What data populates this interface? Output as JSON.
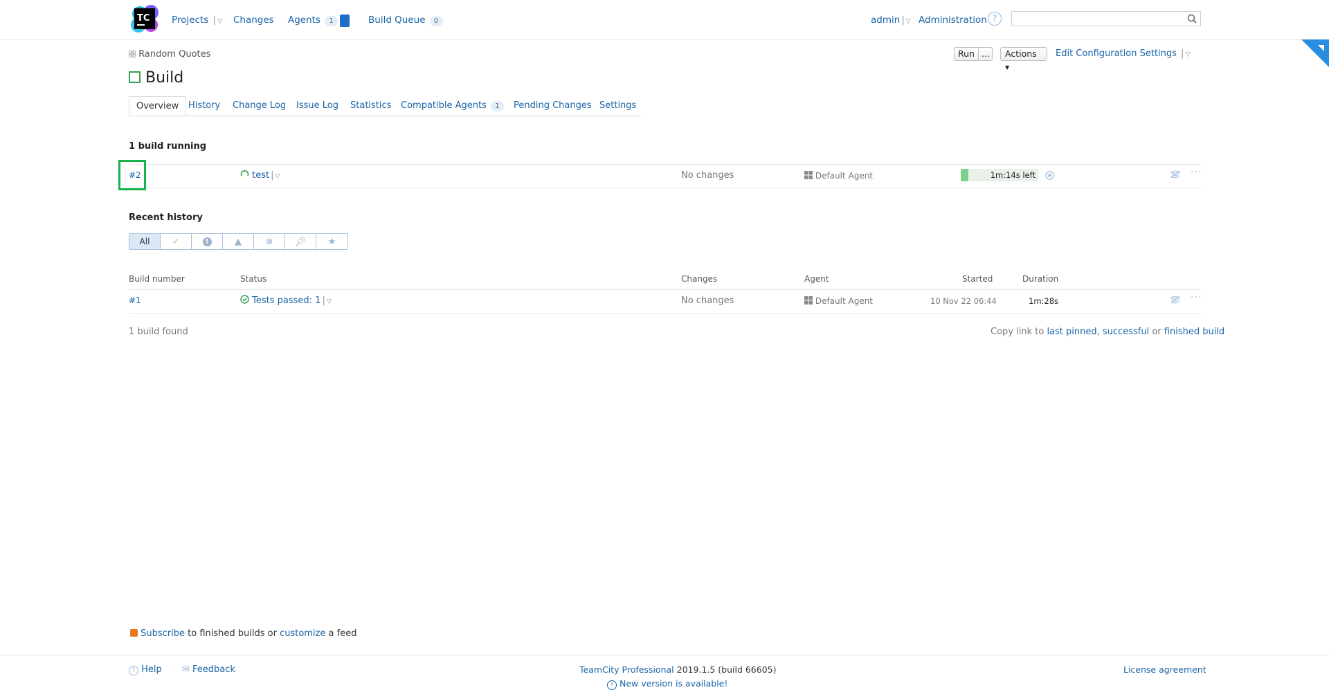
{
  "header": {
    "logo_text": "TC",
    "nav": {
      "projects": "Projects",
      "changes": "Changes",
      "agents": "Agents",
      "agents_count": "1",
      "build_queue": "Build Queue",
      "build_queue_count": "0"
    },
    "user": "admin",
    "administration": "Administration",
    "help_icon": "?",
    "search": {
      "value": "",
      "placeholder": ""
    }
  },
  "breadcrumb": "Random Quotes",
  "page_title": "Build",
  "toolbar": {
    "run": "Run",
    "run_more": "...",
    "actions": "Actions",
    "edit_config": "Edit Configuration Settings"
  },
  "tabs": [
    {
      "label": "Overview",
      "active": true
    },
    {
      "label": "History"
    },
    {
      "label": "Change Log"
    },
    {
      "label": "Issue Log"
    },
    {
      "label": "Statistics"
    },
    {
      "label": "Compatible Agents",
      "count": "1"
    },
    {
      "label": "Pending Changes"
    },
    {
      "label": "Settings"
    }
  ],
  "running": {
    "title": "1 build running",
    "build": {
      "number": "#2",
      "status": "test",
      "changes": "No changes",
      "agent": "Default Agent",
      "progress_text": "1m:14s left",
      "progress_fraction": 0.1
    }
  },
  "recent": {
    "title": "Recent history",
    "filters": [
      "All",
      "check-circle-icon",
      "error-icon",
      "warning-icon",
      "cancel-icon",
      "pin-icon",
      "star-icon"
    ],
    "columns": {
      "build_number": "Build number",
      "status": "Status",
      "changes": "Changes",
      "agent": "Agent",
      "started": "Started",
      "duration": "Duration"
    },
    "rows": [
      {
        "number": "#1",
        "status": "Tests passed: 1",
        "changes": "No changes",
        "agent": "Default Agent",
        "started": "10 Nov 22 06:44",
        "duration": "1m:28s"
      }
    ],
    "found": "1 build found",
    "copy_link": {
      "prefix": "Copy link to",
      "last_pinned": "last pinned",
      "comma": ",",
      "successful": "successful",
      "or": "or",
      "finished_build": "finished build"
    }
  },
  "feed": {
    "subscribe": "Subscribe",
    "middle": "to finished builds or",
    "customize": "customize",
    "suffix": "a feed"
  },
  "footer": {
    "help": "Help",
    "feedback": "Feedback",
    "product": "TeamCity Professional",
    "version": "2019.1.5 (build 66605)",
    "new_version": "New version is available!",
    "license": "License agreement"
  },
  "colors": {
    "link": "#1a64a8",
    "success": "#31a04f",
    "highlight": "#18b24a",
    "agent_square": "#1d6ec5"
  }
}
